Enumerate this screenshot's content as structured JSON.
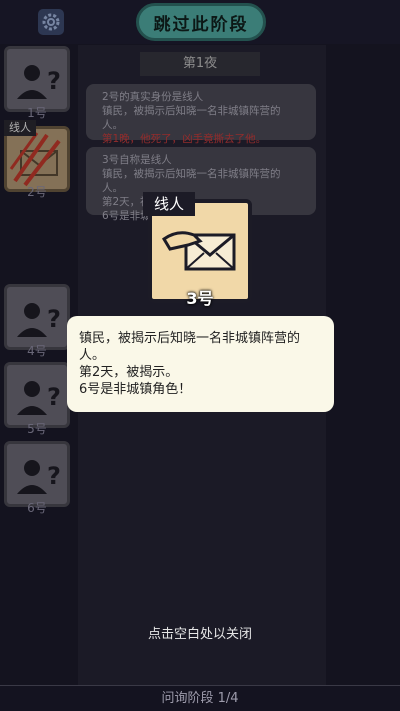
{
  "header": {
    "skip_label": "跳过此阶段"
  },
  "sidebar": {
    "players": [
      {
        "label": "1号",
        "state": "unknown"
      },
      {
        "label": "2号",
        "state": "dead",
        "role": "线人"
      },
      {
        "label": "4号",
        "state": "unknown"
      },
      {
        "label": "5号",
        "state": "unknown"
      },
      {
        "label": "6号",
        "state": "unknown"
      }
    ]
  },
  "main": {
    "night_label": "第1夜",
    "cards": [
      {
        "line1": "2号的真实身份是线人",
        "line2": "镇民，被揭示后知晓一名非城镇阵营的人。",
        "line3": "第1晚，他死了，凶手竟撕去了他。"
      },
      {
        "line1": "3号自称是线人",
        "line2": "镇民，被揭示后知晓一名非城镇阵营的人。",
        "line3": "第2天，被揭示。",
        "line4": "6号是非城镇角色！"
      }
    ]
  },
  "focus_card": {
    "role": "线人",
    "number": "3号"
  },
  "popup": {
    "line1": "镇民，被揭示后知晓一名非城镇阵营的",
    "line2": "人。",
    "line3": "第2天，被揭示。",
    "line4": "6号是非城镇角色！"
  },
  "hint": "点击空白处以关闭",
  "footer": {
    "phase_label": "问询阶段 1/4"
  },
  "colors": {
    "accent": "#4fa79f",
    "dead_card": "#b19774",
    "claw": "#c0392b",
    "popup_bg": "#faf8e8"
  }
}
